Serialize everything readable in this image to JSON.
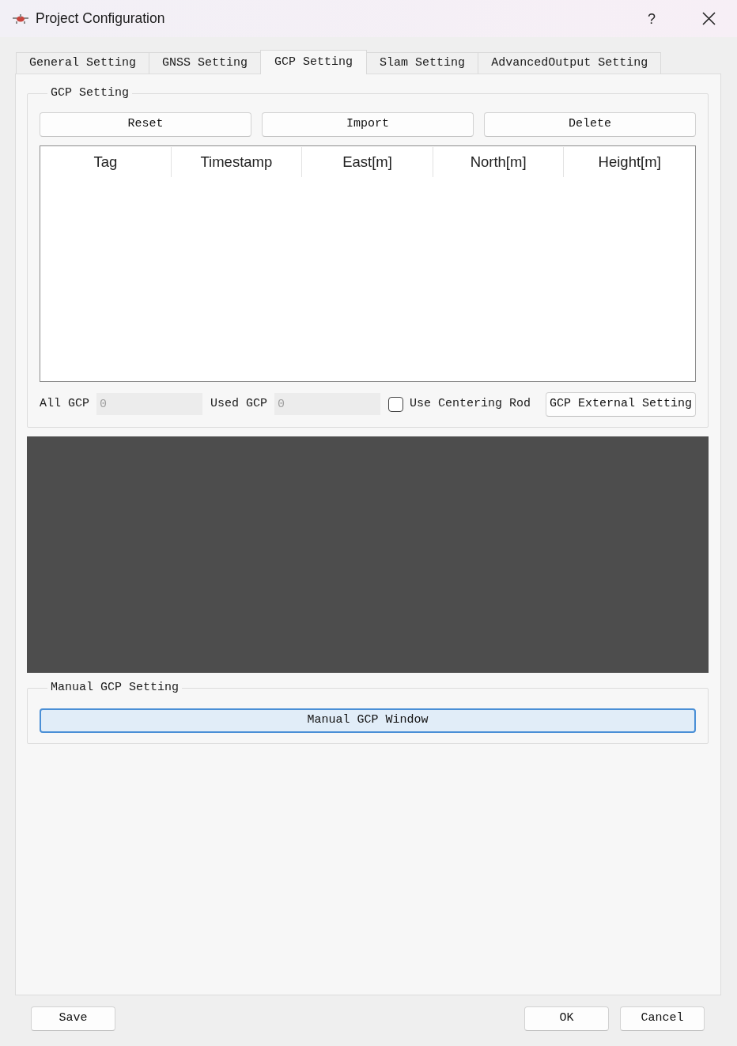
{
  "window": {
    "title": "Project Configuration",
    "help": "?"
  },
  "tabs": [
    {
      "label": "General Setting",
      "selected": false
    },
    {
      "label": "GNSS Setting",
      "selected": false
    },
    {
      "label": "GCP Setting",
      "selected": true
    },
    {
      "label": "Slam Setting",
      "selected": false
    },
    {
      "label": "AdvancedOutput Setting",
      "selected": false
    }
  ],
  "gcp_group": {
    "title": "GCP Setting",
    "buttons": [
      "Reset",
      "Import",
      "Delete"
    ],
    "columns": [
      "Tag",
      "Timestamp",
      "East[m]",
      "North[m]",
      "Height[m]"
    ],
    "fields": [
      {
        "label": "All GCP",
        "value": "0",
        "disabled": true
      },
      {
        "label": "Used GCP",
        "value": "0",
        "disabled": true
      }
    ],
    "centering_rod": {
      "label": "Use Centering Rod",
      "checked": false
    },
    "external_button": "GCP External Setting"
  },
  "manual_group": {
    "title": "Manual GCP Setting",
    "button": {
      "label": "Manual GCP Window",
      "focused": true
    }
  },
  "footer": {
    "left_buttons": [
      "Save"
    ],
    "right_buttons": [
      "OK",
      "Cancel"
    ]
  }
}
